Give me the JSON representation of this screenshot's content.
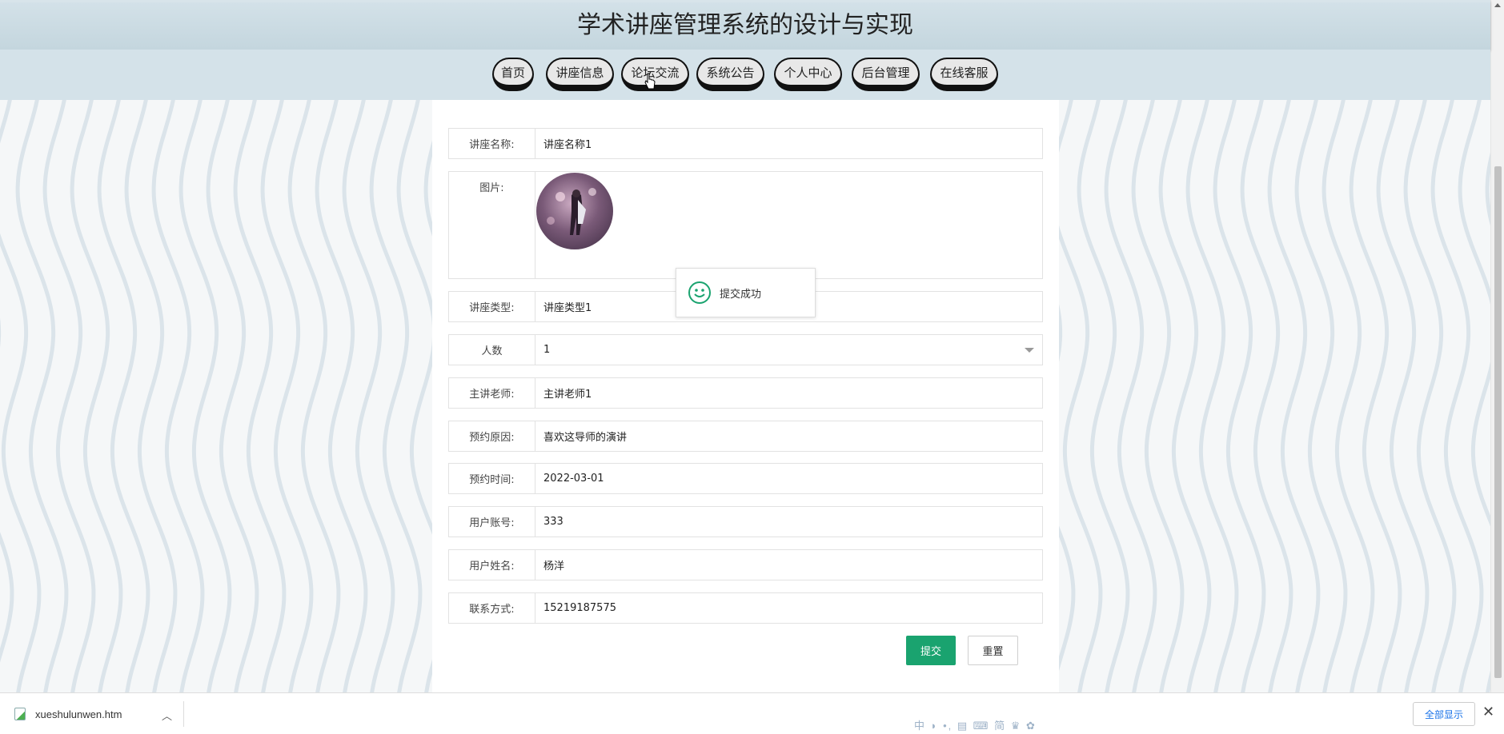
{
  "header": {
    "title": "学术讲座管理系统的设计与实现"
  },
  "nav": {
    "items": [
      {
        "label": "首页"
      },
      {
        "label": "讲座信息"
      },
      {
        "label": "论坛交流"
      },
      {
        "label": "系统公告"
      },
      {
        "label": "个人中心"
      },
      {
        "label": "后台管理"
      },
      {
        "label": "在线客服"
      }
    ]
  },
  "form": {
    "fields": [
      {
        "label": "讲座名称:",
        "value": "讲座名称1"
      },
      {
        "label": "图片:",
        "value": ""
      },
      {
        "label": "讲座类型:",
        "value": "讲座类型1"
      },
      {
        "label": "人数",
        "value": "1"
      },
      {
        "label": "主讲老师:",
        "value": "主讲老师1"
      },
      {
        "label": "预约原因:",
        "value": "喜欢这导师的演讲"
      },
      {
        "label": "预约时间:",
        "value": "2022-03-01"
      },
      {
        "label": "用户账号:",
        "value": "333"
      },
      {
        "label": "用户姓名:",
        "value": "杨洋"
      },
      {
        "label": "联系方式:",
        "value": "15219187575"
      }
    ],
    "submit_label": "提交",
    "reset_label": "重置"
  },
  "toast": {
    "message": "提交成功",
    "icon": "smile-icon"
  },
  "download_bar": {
    "filename": "xueshulunwen.htm",
    "show_all_label": "全部显示",
    "close_label": "✕"
  },
  "ime_toolbar": "中 ◗ •, ▤ ⌨ 简 ♛ ✿",
  "colors": {
    "accent": "#1aa36f",
    "header_bg": "#d4e2e9"
  }
}
